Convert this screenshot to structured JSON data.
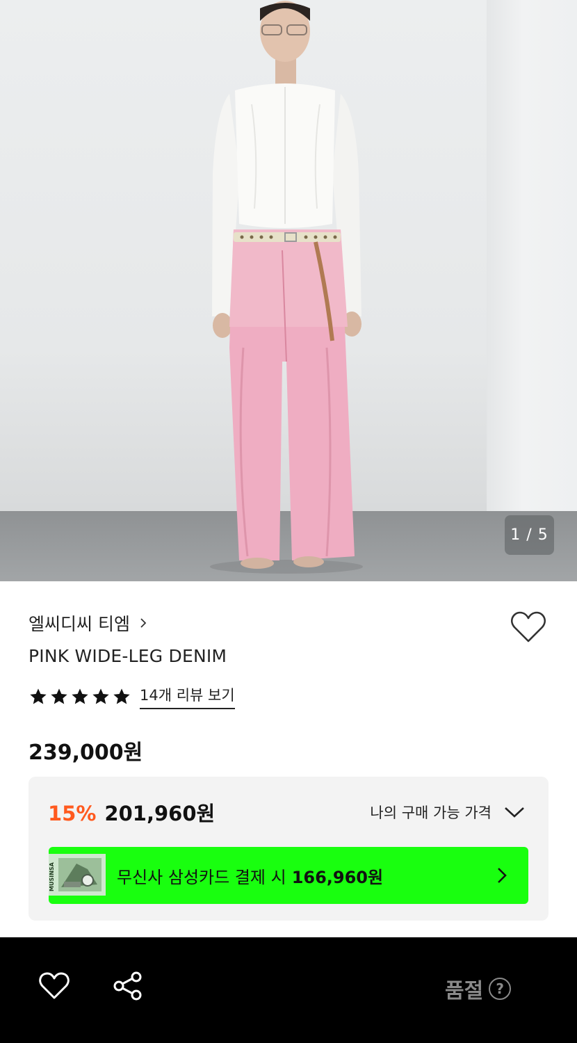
{
  "gallery": {
    "counter": "1 / 5"
  },
  "product": {
    "brand": "엘씨디씨 티엠",
    "title": "PINK WIDE-LEG DENIM",
    "review_link": "14개 리뷰 보기",
    "rating": 5,
    "price": "239,000원"
  },
  "discount": {
    "rate": "15%",
    "amount": "201,960원",
    "my_price_label": "나의 구매 가능 가격"
  },
  "card_promo": {
    "text": "무신사 삼성카드 결제 시",
    "amount": "166,960원",
    "thumb_text": "MUSINSA",
    "color": "#19ff0f"
  },
  "bottom_bar": {
    "status": "품절",
    "help_glyph": "?"
  },
  "colors": {
    "accent_discount": "#ff5a1f",
    "bar_bg": "#000000"
  },
  "icons": [
    "chevron-right-icon",
    "heart-icon",
    "star-icon",
    "chevron-down-icon",
    "share-icon",
    "question-icon"
  ]
}
